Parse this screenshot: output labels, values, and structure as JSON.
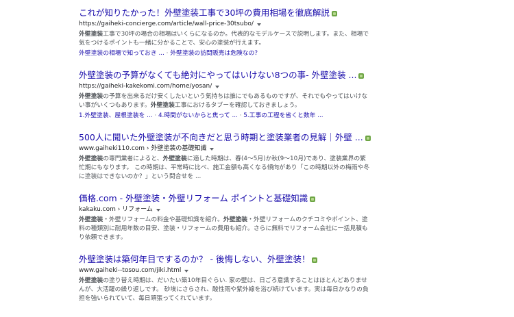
{
  "results": [
    {
      "title": "これが知りたかった！外壁塗装工事で30坪の費用相場を徹底解説",
      "url": "https://gaiheki-concierge.com/article/wall-price-30tsubo/",
      "snippet_parts": [
        {
          "text": "外壁塗装",
          "bold": true
        },
        {
          "text": "工事で30坪の場合の相場はいくらになるのか。代表的なモデルケースで説明します。また、相場で気をつけるポイントも一緒に分かることで、安心の塗装が行えます。",
          "bold": false
        }
      ],
      "sitelinks": [
        "外壁塗装の相場で知っておき ...",
        "外壁塗装の訪問販売は危険なの？"
      ]
    },
    {
      "title": "外壁塗装の予算がなくても絶対にやってはいけない8つの事- 外壁塗装 ...",
      "url": "https://gaiheki-kakekomi.com/home/yosan/",
      "snippet_parts": [
        {
          "text": "外壁塗装",
          "bold": true
        },
        {
          "text": "の予算を出来るだけ安くしたいという気持ちは誰にでもあるものですが、それでもやってはいけない事がいくつもあります。",
          "bold": false
        },
        {
          "text": "外壁塗装",
          "bold": true
        },
        {
          "text": "工事におけるタブーを確認しておきましょう。",
          "bold": false
        }
      ],
      "sitelinks": [
        "1.外壁塗装、屋根塗装を ...",
        "4.時間がないからと焦って ...",
        "5.工事の工程を省くと数年 ..."
      ]
    },
    {
      "title": "500人に聞いた外壁塗装が不向きだと思う時期と塗装業者の見解｜外壁 ...",
      "url": "www.gaiheki110.com › 外壁塗装の基礎知識",
      "snippet_parts": [
        {
          "text": "外壁塗装",
          "bold": true
        },
        {
          "text": "の専門業者によると、",
          "bold": false
        },
        {
          "text": "外壁塗装",
          "bold": true
        },
        {
          "text": "に適した時期は、春(4〜5月)か秋(9〜10月)であり、塗装業界の繁忙期にもなります。 この時期は、平常時に比べ、施工金額も高くなる傾向があり「この時期以外の梅雨や冬に塗装はできないのか？」という問合せを ...",
          "bold": false
        }
      ],
      "sitelinks": []
    },
    {
      "title": "価格.com - 外壁塗装・外壁リフォーム ポイントと基礎知識",
      "url": "kakaku.com › リフォーム",
      "snippet_parts": [
        {
          "text": "外壁塗装",
          "bold": true
        },
        {
          "text": "・外壁リフォームの料金や基礎知識を紹介。",
          "bold": false
        },
        {
          "text": "外壁塗装",
          "bold": true
        },
        {
          "text": "・外壁リフォームのクチコミやポイント、塗料の種類別に耐用年数の目安、塗装・リフォームの費用も紹介。さらに無料でリフォーム会社に一括見積もり依頼できます。",
          "bold": false
        }
      ],
      "sitelinks": []
    },
    {
      "title": "外壁塗装は築何年目でするのか？ - 後悔しない、外壁塗装！",
      "url": "www.gaiheki--tosou.com/jiki.html",
      "snippet_parts": [
        {
          "text": "外壁塗装",
          "bold": true
        },
        {
          "text": "の塗り替え時期は、だいたい築10年目ぐらい. 家の壁は、日ごろ意識することはほとんどありませんが、大活躍の繰り返しです。 砂埃にさらされ、酸性雨や紫外線を浴び続けています。実は毎日かなりの負担を強いられていて、毎日頑張ってくれています。",
          "bold": false
        }
      ],
      "sitelinks": []
    }
  ]
}
